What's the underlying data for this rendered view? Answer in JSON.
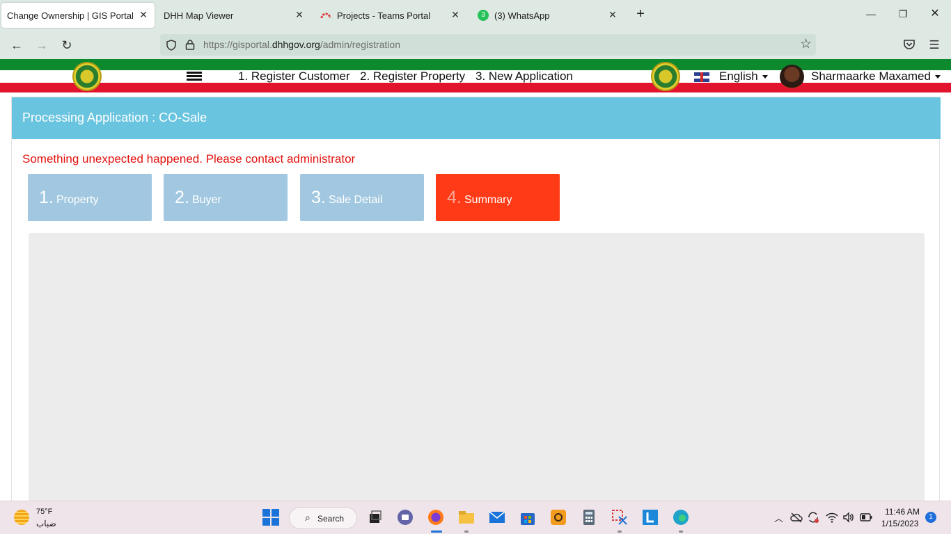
{
  "browser": {
    "tabs": [
      {
        "title": "Change Ownership | GIS Portal",
        "active": true
      },
      {
        "title": "DHH Map Viewer",
        "active": false
      },
      {
        "title": "Projects - Teams Portal",
        "active": false
      },
      {
        "title": "(3) WhatsApp",
        "active": false,
        "badge": "3"
      }
    ],
    "new_tab_icon": "+",
    "url_prefix": "https://gisportal.",
    "url_domain": "dhhgov.org",
    "url_path": "/admin/registration"
  },
  "header": {
    "menu": {
      "register_customer": "1. Register Customer",
      "register_property": "2. Register Property",
      "new_application": "3. New Application"
    },
    "language": "English",
    "user_name": "Sharmaarke Maxamed"
  },
  "panel": {
    "title": "Processing Application : CO-Sale",
    "error": "Something unexpected happened. Please contact administrator",
    "steps": [
      {
        "number": "1.",
        "label": "Property",
        "active": false
      },
      {
        "number": "2.",
        "label": "Buyer",
        "active": false
      },
      {
        "number": "3.",
        "label": "Sale Detail",
        "active": false
      },
      {
        "number": "4.",
        "label": "Summary",
        "active": true
      }
    ]
  },
  "taskbar": {
    "weather_temp": "75°F",
    "weather_desc": "ضباب",
    "search_label": "Search",
    "time": "11:46 AM",
    "date": "1/15/2023",
    "notifications": "1"
  },
  "colors": {
    "heading_bg": "#69c4df",
    "step_inactive": "#a1c8e0",
    "step_active": "#ff3a16",
    "error_text": "#e2100c",
    "flag_green": "#0d8a2e",
    "flag_red": "#e2142d"
  }
}
